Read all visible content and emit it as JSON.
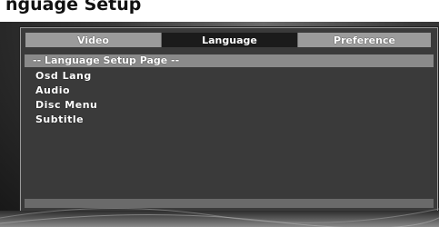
{
  "header": {
    "title": "nguage Setup"
  },
  "tabs": [
    {
      "label": "Video",
      "active": false
    },
    {
      "label": "Language",
      "active": true
    },
    {
      "label": "Preference",
      "active": false
    }
  ],
  "page": {
    "title": "-- Language Setup Page --"
  },
  "menu": {
    "items": [
      {
        "label": "Osd Lang"
      },
      {
        "label": "Audio"
      },
      {
        "label": "Disc Menu"
      },
      {
        "label": "Subtitle"
      }
    ]
  },
  "colors": {
    "active_tab": "#1b1b1b",
    "inactive_tab": "#9b9b9b",
    "panel": "#3a3a3a",
    "title_bar": "#8a8a8a"
  }
}
